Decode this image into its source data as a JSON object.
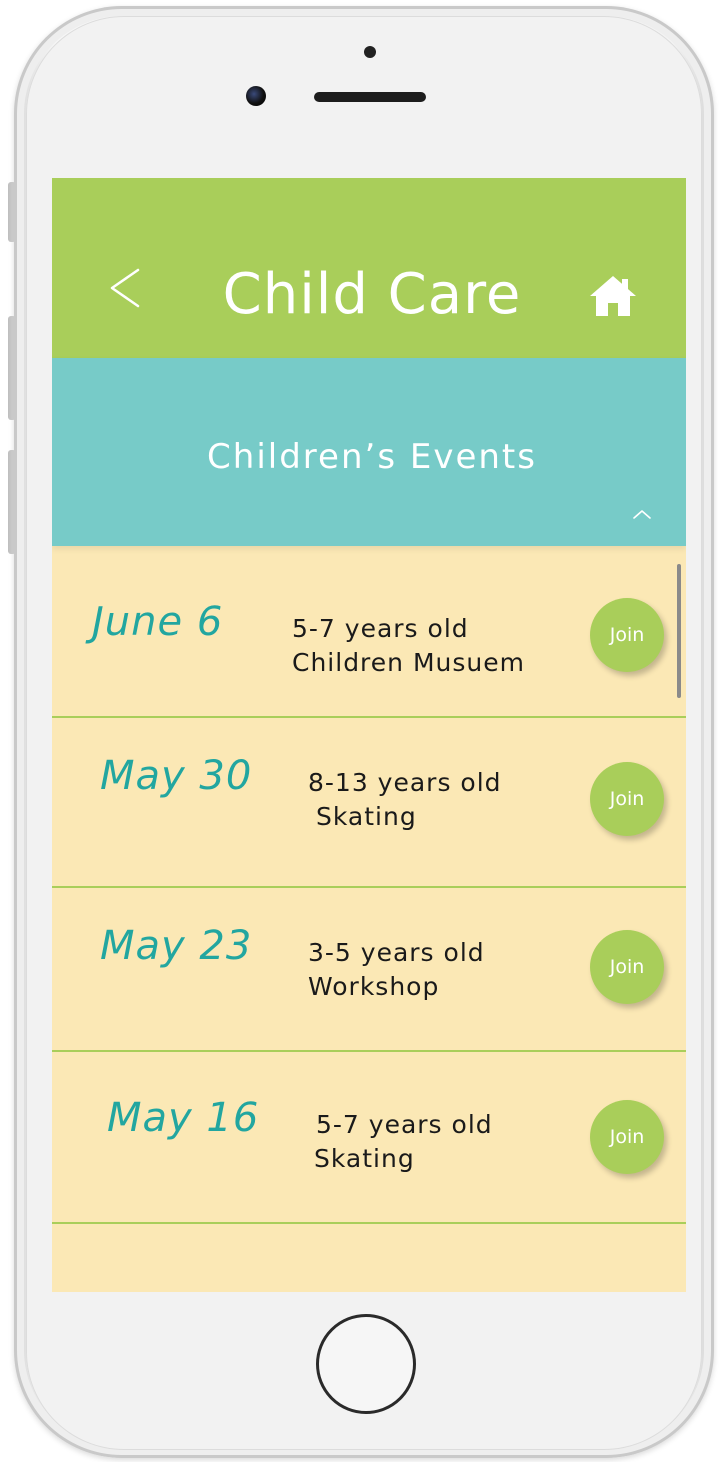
{
  "header": {
    "title": "Child Care",
    "back_icon": "chevron-left-icon",
    "home_icon": "home-icon"
  },
  "section": {
    "title": "Children’s Events",
    "collapse_icon": "chevron-up-icon"
  },
  "events": [
    {
      "date": "June 6",
      "age": "5-7 years old",
      "name": "Children Musuem",
      "action": "Join"
    },
    {
      "date": "May 30",
      "age": "8-13 years old",
      "name": "Skating",
      "action": "Join"
    },
    {
      "date": "May 23",
      "age": "3-5 years old",
      "name": "Workshop",
      "action": "Join"
    },
    {
      "date": "May 16",
      "age": "5-7 years old",
      "name": "Skating",
      "action": "Join"
    }
  ],
  "colors": {
    "header_green": "#a9ce5a",
    "section_teal": "#77cbc8",
    "list_background": "#fbe8b5",
    "date_teal": "#22a6a0",
    "join_button": "#a9ce5a"
  }
}
